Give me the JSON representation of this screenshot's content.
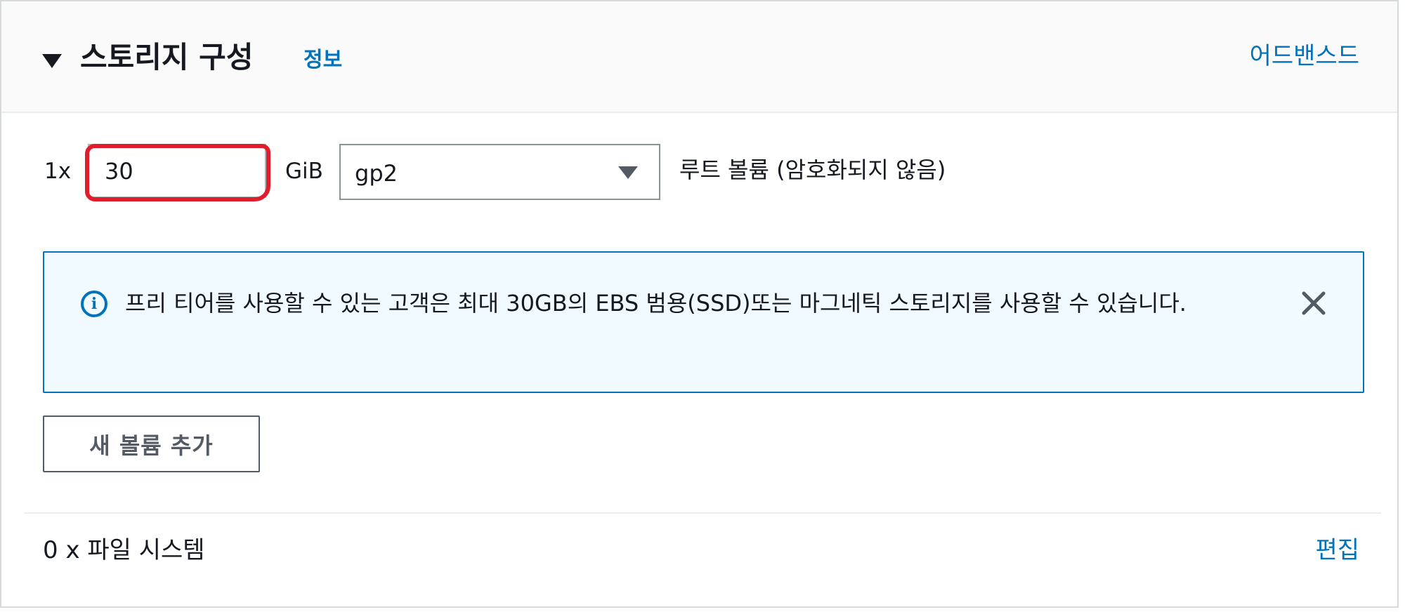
{
  "section": {
    "title": "스토리지 구성",
    "info_link": "정보",
    "advanced_link": "어드밴스드"
  },
  "volume": {
    "quantity": "1x",
    "size_value": "30",
    "unit": "GiB",
    "type": "gp2",
    "description": "루트 볼륨  (암호화되지 않음)"
  },
  "alert": {
    "icon": "info-circle-icon",
    "message": "프리 티어를 사용할 수 있는 고객은 최대 30GB의 EBS 범용(SSD)또는 마그네틱 스토리지를 사용할 수 있습니다."
  },
  "actions": {
    "add_volume": "새 볼륨 추가"
  },
  "file_systems": {
    "label": "0 x 파일 시스템",
    "edit_link": "편집"
  },
  "colors": {
    "link": "#0073bb",
    "alert_border": "#0073bb",
    "alert_background": "#f1faff",
    "annotation": "#e01e2b"
  }
}
